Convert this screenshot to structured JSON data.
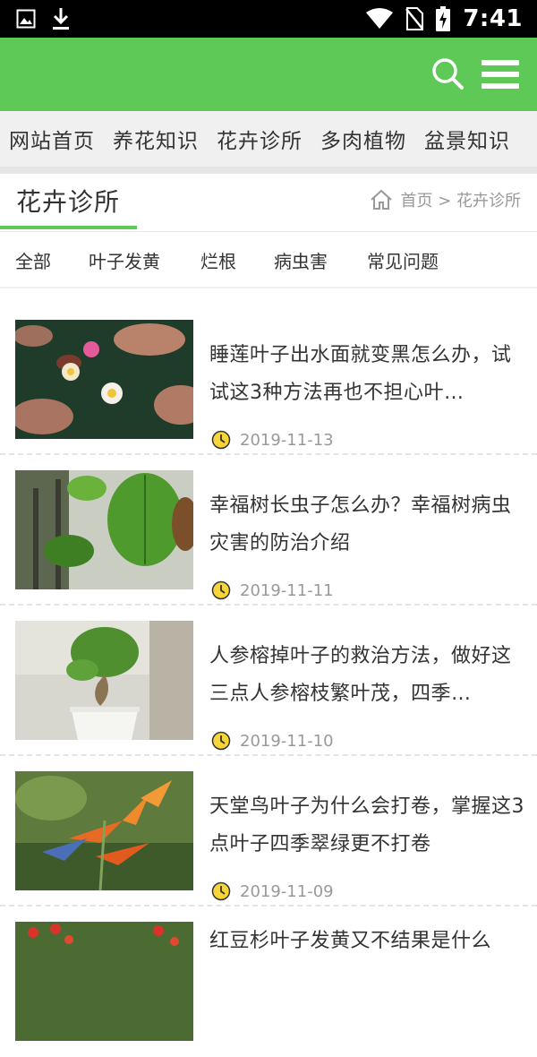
{
  "status_bar": {
    "time": "7:41",
    "icons": [
      "image-icon",
      "download-icon",
      "wifi-icon",
      "no-sim-icon",
      "battery-charging-icon"
    ]
  },
  "app_bar": {
    "bg_color": "#5ec957",
    "icons": [
      "search-icon",
      "menu-icon"
    ]
  },
  "nav": {
    "items": [
      "网站首页",
      "养花知识",
      "花卉诊所",
      "多肉植物",
      "盆景知识"
    ]
  },
  "section": {
    "title": "花卉诊所",
    "breadcrumb": "首页 > 花卉诊所"
  },
  "tabs": [
    "全部",
    "叶子发黄",
    "烂根",
    "病虫害",
    "常见问题"
  ],
  "articles": [
    {
      "title": "睡莲叶子出水面就变黑怎么办，试试这3种方法再也不担心叶…",
      "date": "2019-11-13",
      "thumb": "water-lily"
    },
    {
      "title": "幸福树长虫子怎么办？幸福树病虫灾害的防治介绍",
      "date": "2019-11-11",
      "thumb": "green-leaf"
    },
    {
      "title": "人参榕掉叶子的救治方法，做好这三点人参榕枝繁叶茂，四季…",
      "date": "2019-11-10",
      "thumb": "ginseng-ficus"
    },
    {
      "title": "天堂鸟叶子为什么会打卷，掌握这3点叶子四季翠绿更不打卷",
      "date": "2019-11-09",
      "thumb": "bird-of-paradise"
    },
    {
      "title": "红豆杉叶子发黄又不结果是什么",
      "date": "",
      "thumb": "red-berries"
    }
  ]
}
